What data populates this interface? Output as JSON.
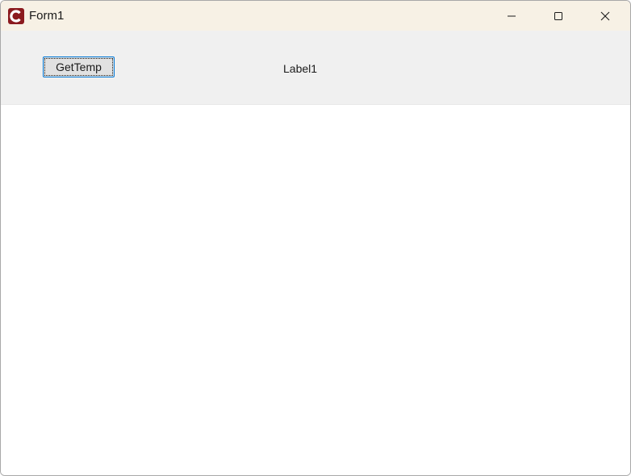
{
  "window": {
    "title": "Form1",
    "icon": "app-c-icon",
    "title_bar_color": "#f7f1e5",
    "controls": {
      "minimize_icon": "minimize-icon",
      "maximize_icon": "maximize-icon",
      "close_icon": "close-icon"
    }
  },
  "form": {
    "button_label": "GetTemp",
    "label_text": "Label1",
    "panel_color": "#f0f0f0"
  }
}
